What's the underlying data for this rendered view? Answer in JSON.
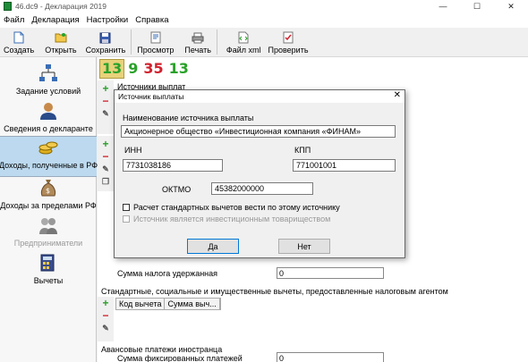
{
  "window": {
    "title": "46.dc9 - Декларация 2019",
    "minimize": "—",
    "maximize": "☐",
    "close": "✕"
  },
  "menu": [
    "Файл",
    "Декларация",
    "Настройки",
    "Справка"
  ],
  "toolbar": {
    "create": "Создать",
    "open": "Открыть",
    "save": "Сохранить",
    "preview": "Просмотр",
    "print": "Печать",
    "xml": "Файл xml",
    "check": "Проверить"
  },
  "sidebar": {
    "items": [
      {
        "label": "Задание условий"
      },
      {
        "label": "Сведения о декларанте"
      },
      {
        "label": "Доходы, полученные в РФ"
      },
      {
        "label": "Доходы за пределами РФ"
      },
      {
        "label": "Предприниматели"
      },
      {
        "label": "Вычеты"
      }
    ]
  },
  "rate_tabs": [
    "13",
    "9",
    "35",
    "13"
  ],
  "main": {
    "sources_title": "Источники выплат",
    "tax_withheld_label": "Сумма налога удержанная",
    "tax_withheld_value": "0",
    "deductions_title": "Стандартные, социальные и имущественные вычеты, предоставленные налоговым агентом",
    "col_code": "Код вычета",
    "col_sum": "Сумма выч...",
    "advances_title": "Авансовые платежи иностранца",
    "fixed_payments_label": "Сумма фиксированных платежей",
    "fixed_payments_value": "0"
  },
  "dialog": {
    "title": "Источник выплаты",
    "close": "✕",
    "name_label": "Наименование источника выплаты",
    "name_value": "Акционерное общество «Инвестиционная компания «ФИНАМ»",
    "inn_label": "ИНН",
    "inn_value": "7731038186",
    "kpp_label": "КПП",
    "kpp_value": "771001001",
    "oktmo_label": "ОКТМО",
    "oktmo_value": "45382000000",
    "check1": "Расчет стандартных вычетов вести по этому источнику",
    "check2": "Источник является инвестиционным товариществом",
    "yes": "Да",
    "no": "Нет"
  },
  "colors": {
    "accent": "#0078d7",
    "active_item": "#bcd9ef",
    "tab_red": "#d1222e",
    "tab_green": "#2aa12a",
    "tab_yellow": "#e8d27a"
  }
}
